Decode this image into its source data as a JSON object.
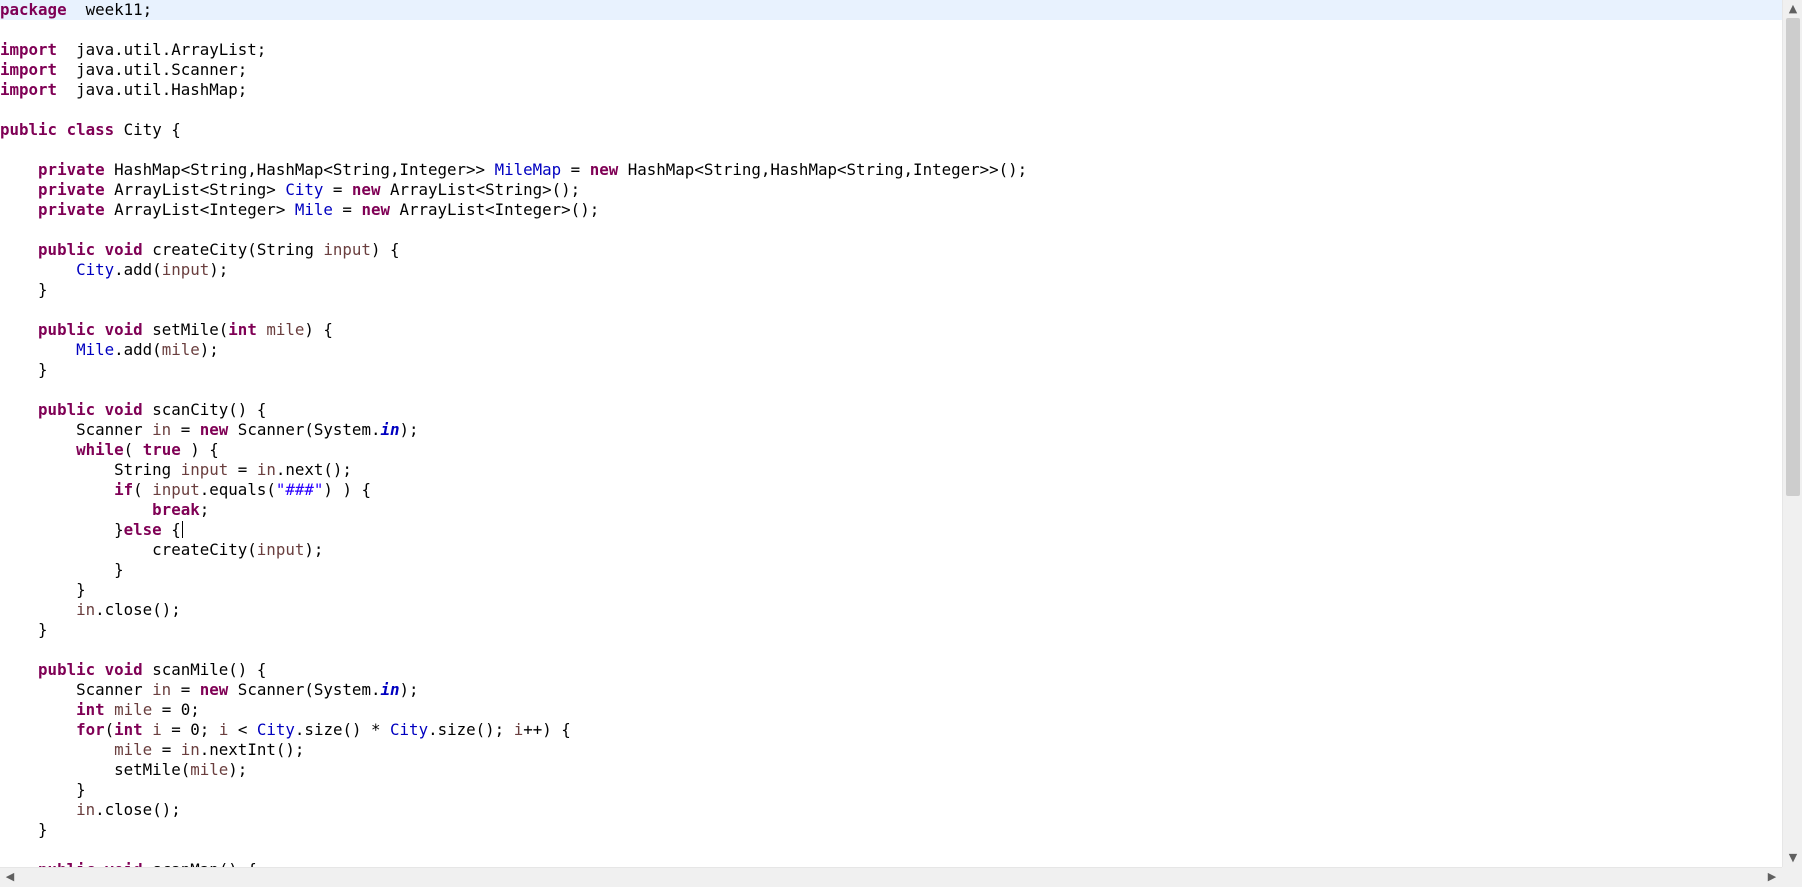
{
  "editor": {
    "language": "java",
    "lines": [
      [
        [
          "k",
          "package"
        ],
        [
          "",
          "  week11;"
        ]
      ],
      [],
      [
        [
          "k",
          "import"
        ],
        [
          "",
          "  java.util.ArrayList;"
        ]
      ],
      [
        [
          "k",
          "import"
        ],
        [
          "",
          "  java.util.Scanner;"
        ]
      ],
      [
        [
          "k",
          "import"
        ],
        [
          "",
          "  java.util.HashMap;"
        ]
      ],
      [],
      [
        [
          "k",
          "public"
        ],
        [
          "",
          " "
        ],
        [
          "k",
          "class"
        ],
        [
          "",
          " City {"
        ]
      ],
      [],
      [
        [
          "",
          "    "
        ],
        [
          "k",
          "private"
        ],
        [
          "",
          " HashMap<String,HashMap<String,Integer>> "
        ],
        [
          "f",
          "MileMap"
        ],
        [
          "",
          " = "
        ],
        [
          "k",
          "new"
        ],
        [
          "",
          " HashMap<String,HashMap<String,Integer>>();"
        ]
      ],
      [
        [
          "",
          "    "
        ],
        [
          "k",
          "private"
        ],
        [
          "",
          " ArrayList<String> "
        ],
        [
          "f",
          "City"
        ],
        [
          "",
          " = "
        ],
        [
          "k",
          "new"
        ],
        [
          "",
          " ArrayList<String>();"
        ]
      ],
      [
        [
          "",
          "    "
        ],
        [
          "k",
          "private"
        ],
        [
          "",
          " ArrayList<Integer> "
        ],
        [
          "f",
          "Mile"
        ],
        [
          "",
          " = "
        ],
        [
          "k",
          "new"
        ],
        [
          "",
          " ArrayList<Integer>();"
        ]
      ],
      [],
      [
        [
          "",
          "    "
        ],
        [
          "k",
          "public"
        ],
        [
          "",
          " "
        ],
        [
          "k",
          "void"
        ],
        [
          "",
          " createCity(String "
        ],
        [
          "v",
          "input"
        ],
        [
          "",
          ") {"
        ]
      ],
      [
        [
          "",
          "        "
        ],
        [
          "f",
          "City"
        ],
        [
          "",
          ".add("
        ],
        [
          "v",
          "input"
        ],
        [
          "",
          ");"
        ]
      ],
      [
        [
          "",
          "    }"
        ]
      ],
      [],
      [
        [
          "",
          "    "
        ],
        [
          "k",
          "public"
        ],
        [
          "",
          " "
        ],
        [
          "k",
          "void"
        ],
        [
          "",
          " setMile("
        ],
        [
          "k",
          "int"
        ],
        [
          "",
          " "
        ],
        [
          "v",
          "mile"
        ],
        [
          "",
          ") {"
        ]
      ],
      [
        [
          "",
          "        "
        ],
        [
          "f",
          "Mile"
        ],
        [
          "",
          ".add("
        ],
        [
          "v",
          "mile"
        ],
        [
          "",
          ");"
        ]
      ],
      [
        [
          "",
          "    }"
        ]
      ],
      [],
      [
        [
          "",
          "    "
        ],
        [
          "k",
          "public"
        ],
        [
          "",
          " "
        ],
        [
          "k",
          "void"
        ],
        [
          "",
          " scanCity() {"
        ]
      ],
      [
        [
          "",
          "        Scanner "
        ],
        [
          "v",
          "in"
        ],
        [
          "",
          " = "
        ],
        [
          "k",
          "new"
        ],
        [
          "",
          " Scanner(System."
        ],
        [
          "sf",
          "in"
        ],
        [
          "",
          ");"
        ]
      ],
      [
        [
          "",
          "        "
        ],
        [
          "k",
          "while"
        ],
        [
          "",
          "( "
        ],
        [
          "k",
          "true"
        ],
        [
          "",
          " ) {"
        ]
      ],
      [
        [
          "",
          "            String "
        ],
        [
          "v",
          "input"
        ],
        [
          "",
          " = "
        ],
        [
          "v",
          "in"
        ],
        [
          "",
          ".next();"
        ]
      ],
      [
        [
          "",
          "            "
        ],
        [
          "k",
          "if"
        ],
        [
          "",
          "( "
        ],
        [
          "v",
          "input"
        ],
        [
          "",
          ".equals("
        ],
        [
          "s",
          "\"###\""
        ],
        [
          "",
          ") ) {"
        ]
      ],
      [
        [
          "",
          "                "
        ],
        [
          "k",
          "break"
        ],
        [
          "",
          ";"
        ]
      ],
      [
        [
          "",
          "            }"
        ],
        [
          "k",
          "else"
        ],
        [
          "",
          " {"
        ],
        [
          "caret",
          ""
        ]
      ],
      [
        [
          "",
          "                createCity("
        ],
        [
          "v",
          "input"
        ],
        [
          "",
          ");"
        ]
      ],
      [
        [
          "",
          "            }"
        ]
      ],
      [
        [
          "",
          "        }"
        ]
      ],
      [
        [
          "",
          "        "
        ],
        [
          "v",
          "in"
        ],
        [
          "",
          ".close();"
        ]
      ],
      [
        [
          "",
          "    }"
        ]
      ],
      [],
      [
        [
          "",
          "    "
        ],
        [
          "k",
          "public"
        ],
        [
          "",
          " "
        ],
        [
          "k",
          "void"
        ],
        [
          "",
          " scanMile() {"
        ]
      ],
      [
        [
          "",
          "        Scanner "
        ],
        [
          "v",
          "in"
        ],
        [
          "",
          " = "
        ],
        [
          "k",
          "new"
        ],
        [
          "",
          " Scanner(System."
        ],
        [
          "sf",
          "in"
        ],
        [
          "",
          ");"
        ]
      ],
      [
        [
          "",
          "        "
        ],
        [
          "k",
          "int"
        ],
        [
          "",
          " "
        ],
        [
          "v",
          "mile"
        ],
        [
          "",
          " = 0;"
        ]
      ],
      [
        [
          "",
          "        "
        ],
        [
          "k",
          "for"
        ],
        [
          "",
          "("
        ],
        [
          "k",
          "int"
        ],
        [
          "",
          " "
        ],
        [
          "v",
          "i"
        ],
        [
          "",
          " = 0; "
        ],
        [
          "v",
          "i"
        ],
        [
          "",
          " < "
        ],
        [
          "f",
          "City"
        ],
        [
          "",
          ".size() * "
        ],
        [
          "f",
          "City"
        ],
        [
          "",
          ".size(); "
        ],
        [
          "v",
          "i"
        ],
        [
          "",
          "++) {"
        ]
      ],
      [
        [
          "",
          "            "
        ],
        [
          "v",
          "mile"
        ],
        [
          "",
          " = "
        ],
        [
          "v",
          "in"
        ],
        [
          "",
          ".nextInt();"
        ]
      ],
      [
        [
          "",
          "            setMile("
        ],
        [
          "v",
          "mile"
        ],
        [
          "",
          ");"
        ]
      ],
      [
        [
          "",
          "        }"
        ]
      ],
      [
        [
          "",
          "        "
        ],
        [
          "v",
          "in"
        ],
        [
          "",
          ".close();"
        ]
      ],
      [
        [
          "",
          "    }"
        ]
      ],
      [],
      [
        [
          "",
          "    "
        ],
        [
          "k",
          "public"
        ],
        [
          "",
          " "
        ],
        [
          "k",
          "void"
        ],
        [
          "",
          " scanMap() {"
        ]
      ]
    ]
  },
  "scrollbars": {
    "vertical_up_icon": "▲",
    "vertical_down_icon": "▼",
    "horizontal_left_icon": "◀",
    "horizontal_right_icon": "▶"
  }
}
